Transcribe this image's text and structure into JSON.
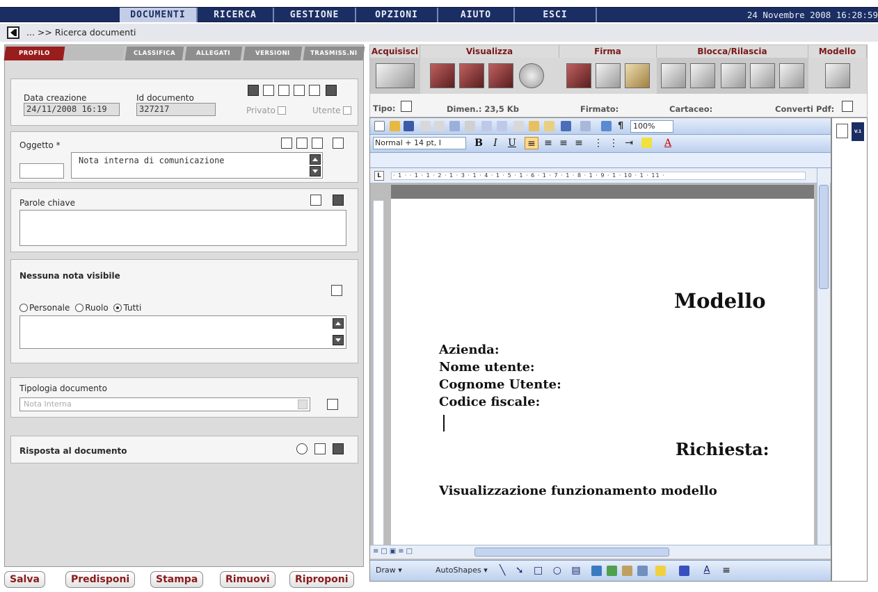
{
  "menu": {
    "items": [
      {
        "label": "DOCUMENTI",
        "active": true
      },
      {
        "label": "RICERCA",
        "active": false
      },
      {
        "label": "GESTIONE",
        "active": false
      },
      {
        "label": "OPZIONI",
        "active": false
      },
      {
        "label": "AIUTO",
        "active": false
      },
      {
        "label": "ESCI",
        "active": false
      }
    ],
    "datetime": "24 Novembre 2008 16:28:59"
  },
  "breadcrumb": {
    "text": "... >> Ricerca documenti"
  },
  "tabs": [
    "PROFILO",
    "CLASSIFICA",
    "ALLEGATI",
    "VERSIONI",
    "TRASMISS.NI"
  ],
  "profile": {
    "data_creazione_label": "Data creazione",
    "data_creazione_value": "24/11/2008 16:19",
    "id_documento_label": "Id documento",
    "id_documento_value": "327217",
    "privato_label": "Privato",
    "utente_label": "Utente",
    "oggetto_label": "Oggetto *",
    "oggetto_value": "Nota interna di comunicazione",
    "parole_chiave_label": "Parole chiave",
    "note_label": "Nessuna nota visibile",
    "radio_personale": "Personale",
    "radio_ruolo": "Ruolo",
    "radio_tutti": "Tutti",
    "tipologia_label": "Tipologia documento",
    "tipologia_value": "Nota Interna",
    "risposta_label": "Risposta al documento"
  },
  "buttons": [
    "Salva",
    "Predisponi",
    "Stampa",
    "Rimuovi",
    "Riproponi"
  ],
  "doc_toolbar": {
    "groups": [
      "Acquisisci",
      "Visualizza",
      "Firma",
      "Blocca/Rilascia",
      "Modello"
    ],
    "tipo_label": "Tipo:",
    "dimen_label": "Dimen.: 23,5 Kb",
    "firmato_label": "Firmato:",
    "cartaceo_label": "Cartaceo:",
    "converti_label": "Converti Pdf:"
  },
  "word": {
    "style_box": "Normal + 14 pt, I",
    "zoom": "100%",
    "ruler": "· 1 · · 1 · 1 · 2 · 1 · 3 · 1 · 4 · 1 · 5 · 1 · 6 · 1 · 7 · 1 · 8 · 1 · 9 · 1 · 10 · 1 · 11 ·",
    "document": {
      "title": "Modello",
      "fields": [
        "Azienda:",
        "Nome utente:",
        "Cognome Utente:",
        "Codice fiscale:"
      ],
      "richiesta": "Richiesta:",
      "body": "Visualizzazione funzionamento modello"
    },
    "draw_label": "Draw",
    "autoshapes_label": "AutoShapes"
  },
  "side": {
    "version_badge": "V.1"
  },
  "colors": {
    "nav": "#1b2e63",
    "accent": "#9a1d1d",
    "button_text": "#8a1c1c"
  }
}
